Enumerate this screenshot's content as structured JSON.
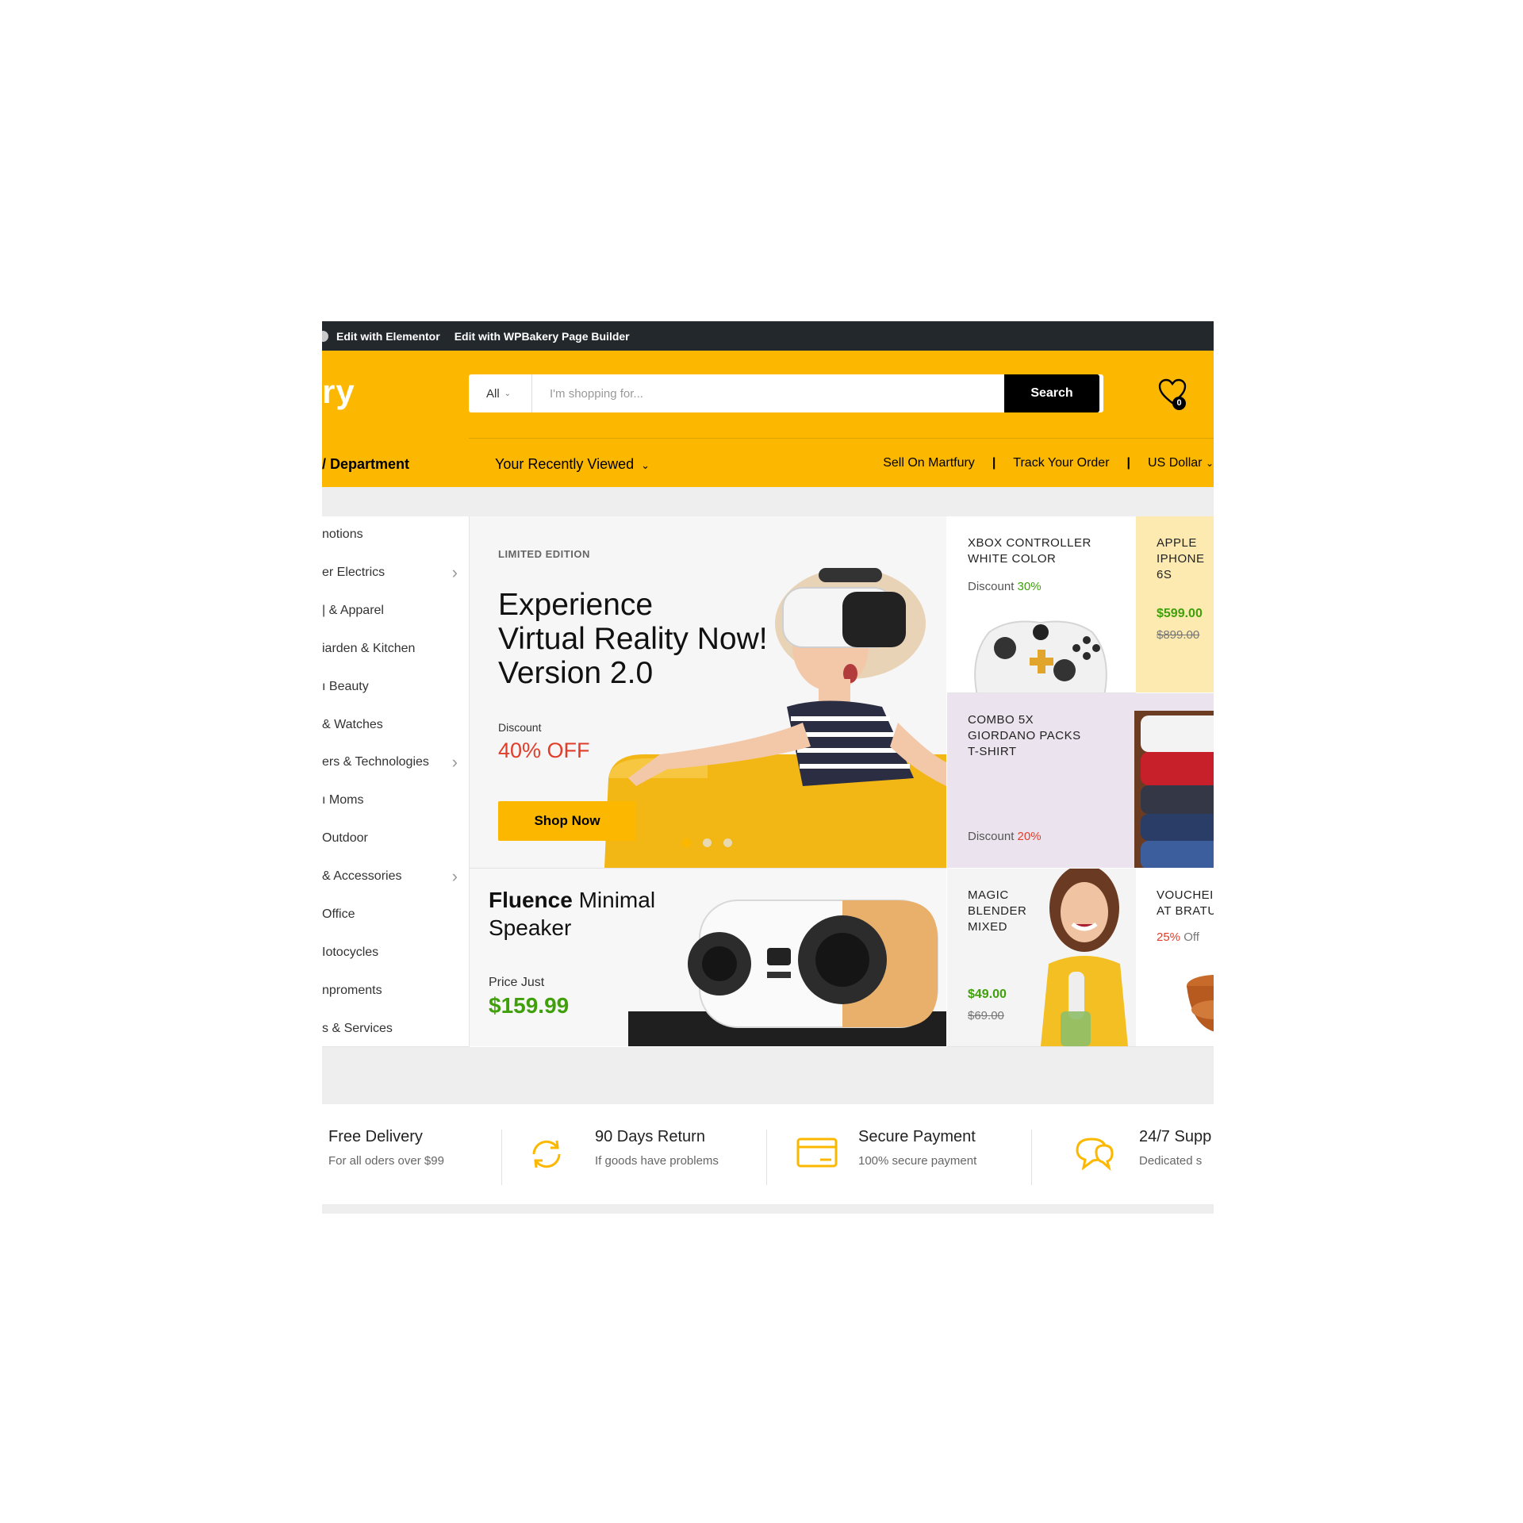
{
  "admin_bar": {
    "links": [
      "Edit with Elementor",
      "Edit with WPBakery Page Builder"
    ]
  },
  "header": {
    "logo_text": "ry",
    "search": {
      "category": "All",
      "placeholder": "I'm shopping for...",
      "button": "Search"
    },
    "wishlist_count": "0",
    "department_label": "/ Department",
    "recently_viewed": "Your Recently Viewed",
    "links": [
      "Sell On Martfury",
      "Track Your Order",
      "US Dollar"
    ]
  },
  "sidebar": {
    "items": [
      {
        "label": "notions",
        "has_arrow": false
      },
      {
        "label": "er Electrics",
        "has_arrow": true
      },
      {
        "label": "| & Apparel",
        "has_arrow": false
      },
      {
        "label": "iarden & Kitchen",
        "has_arrow": false
      },
      {
        "label": "ı Beauty",
        "has_arrow": false
      },
      {
        "label": "& Watches",
        "has_arrow": false
      },
      {
        "label": "ers & Technologies",
        "has_arrow": true
      },
      {
        "label": "ı Moms",
        "has_arrow": false
      },
      {
        "label": "Outdoor",
        "has_arrow": false
      },
      {
        "label": "& Accessories",
        "has_arrow": true
      },
      {
        "label": " Office",
        "has_arrow": false
      },
      {
        "label": "Iotocycles",
        "has_arrow": false
      },
      {
        "label": "nproments",
        "has_arrow": false
      },
      {
        "label": "s & Services",
        "has_arrow": false
      }
    ]
  },
  "hero": {
    "kicker": "LIMITED EDITION",
    "title_lines": [
      "Experience",
      "Virtual Reality Now!",
      "Version 2.0"
    ],
    "discount_label": "Discount",
    "discount_value": "40% OFF",
    "button": "Shop Now",
    "active_slide": 1,
    "slide_count": 3
  },
  "promos": {
    "xbox": {
      "title": [
        "XBOX CONTROLLER",
        "WHITE COLOR"
      ],
      "discount_label": "Discount",
      "discount_value": "30%"
    },
    "iphone": {
      "title": [
        "APPLE",
        "IPHONE",
        "6S"
      ],
      "price": "$599.00",
      "old_price": "$899.00"
    },
    "tshirt": {
      "title": [
        "COMBO 5X",
        "GIORDANO PACKS",
        "T-SHIRT"
      ],
      "discount_label": "Discount",
      "discount_value": "20%"
    },
    "blender": {
      "title": [
        "MAGIC",
        "BLENDER",
        "MIXED"
      ],
      "price": "$49.00",
      "old_price": "$69.00"
    },
    "voucher": {
      "title": [
        "VOUCHEI",
        "AT BRATU"
      ],
      "discount_value": "25%",
      "discount_suffix": "Off"
    }
  },
  "speaker": {
    "title_bold": "Fluence",
    "title_rest": "Minimal",
    "title_line2": "Speaker",
    "price_label": "Price Just",
    "price": "$159.99"
  },
  "features": [
    {
      "title": "Free Delivery",
      "subtitle": "For all oders over $99",
      "icon": ""
    },
    {
      "title": "90 Days Return",
      "subtitle": "If goods have problems",
      "icon": "refresh-icon"
    },
    {
      "title": "Secure Payment",
      "subtitle": "100% secure payment",
      "icon": "credit-card-icon"
    },
    {
      "title": "24/7 Supp",
      "subtitle": "Dedicated s",
      "icon": "chat-icon"
    }
  ],
  "colors": {
    "brand": "#fcb800",
    "admin_bar": "#23282d",
    "discount_red": "#e03d2a",
    "price_green": "#40a00b"
  }
}
